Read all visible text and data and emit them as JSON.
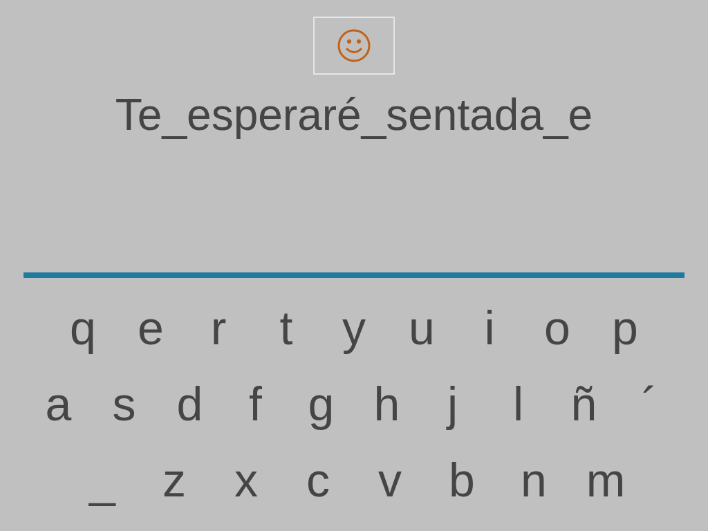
{
  "phrase": "Te_esperaré_sentada_e",
  "keyboard": {
    "rows": [
      [
        "q",
        "e",
        "r",
        "t",
        "y",
        "u",
        "i",
        "o",
        "p"
      ],
      [
        "a",
        "s",
        "d",
        "f",
        "g",
        "h",
        "j",
        "l",
        "ñ",
        "´"
      ],
      [
        "_",
        "z",
        "x",
        "c",
        "v",
        "b",
        "n",
        "m"
      ]
    ]
  }
}
